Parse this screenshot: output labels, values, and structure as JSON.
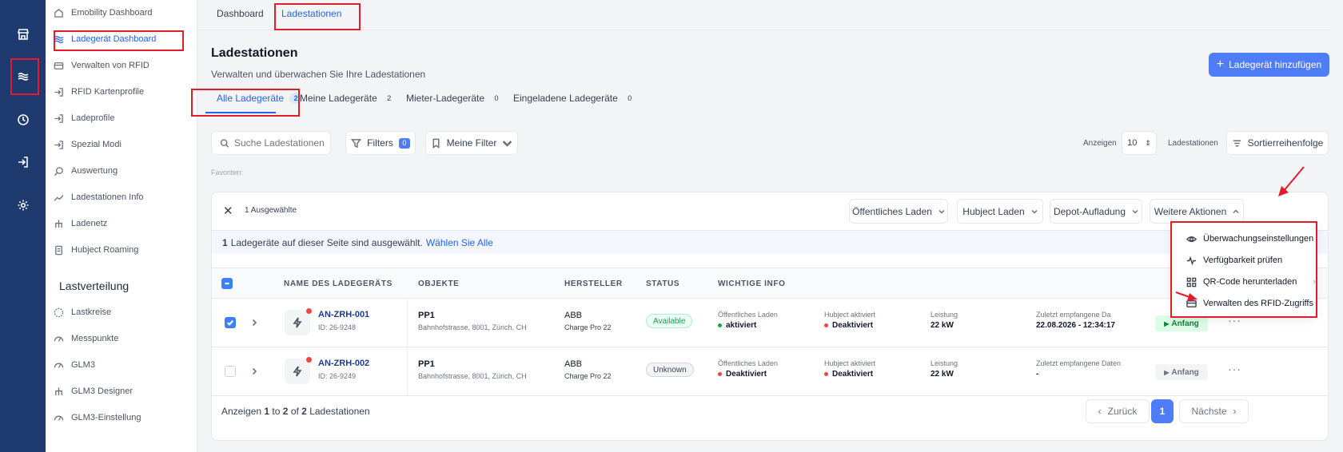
{
  "rail": {
    "icons": [
      "store-icon",
      "charger-waves-icon",
      "clock-icon",
      "login-icon",
      "settings-gear-icon"
    ]
  },
  "nav": {
    "items": [
      {
        "label": "Emobility Dashboard",
        "icon": "home-icon"
      },
      {
        "label": "Ladegerät Dashboard",
        "icon": "waves-icon",
        "active": true
      },
      {
        "label": "Verwalten von RFID",
        "icon": "card-icon"
      },
      {
        "label": "RFID Kartenprofile",
        "icon": "login-arrow-icon"
      },
      {
        "label": "Ladeprofile",
        "icon": "login-arrow-icon"
      },
      {
        "label": "Spezial Modi",
        "icon": "login-arrow-icon"
      },
      {
        "label": "Auswertung",
        "icon": "search-icon"
      },
      {
        "label": "Ladestationen Info",
        "icon": "trend-icon"
      },
      {
        "label": "Ladenetz",
        "icon": "network-icon"
      },
      {
        "label": "Hubject Roaming",
        "icon": "document-icon"
      }
    ],
    "section_title": "Lastverteilung",
    "section_items": [
      {
        "label": "Lastkreise",
        "icon": "circle-dashed-icon"
      },
      {
        "label": "Messpunkte",
        "icon": "gauge-icon"
      },
      {
        "label": "GLM3",
        "icon": "gauge-icon"
      },
      {
        "label": "GLM3 Designer",
        "icon": "network-icon"
      },
      {
        "label": "GLM3-Einstellung",
        "icon": "gauge-icon"
      }
    ]
  },
  "top_tabs": {
    "dashboard": "Dashboard",
    "ladestationen": "Ladestationen"
  },
  "page": {
    "title": "Ladestationen",
    "subtitle": "Verwalten und überwachen Sie Ihre Ladestationen",
    "add_button": "Ladegerät hinzufügen"
  },
  "tabs": [
    {
      "label": "Alle Ladegeräte",
      "count": "2"
    },
    {
      "label": "Meine Ladegeräte",
      "count": "2"
    },
    {
      "label": "Mieter-Ladegeräte",
      "count": "0"
    },
    {
      "label": "Eingeladene Ladegeräte",
      "count": "0"
    }
  ],
  "toolbar": {
    "search_placeholder": "Suche Ladestationen",
    "filters_label": "Filters",
    "filters_count": "0",
    "my_filter_label": "Meine Filter",
    "show_label": "Anzeigen",
    "page_size": "10",
    "page_size_suffix": "Ladestationen",
    "sort_label": "Sortierreihenfolge",
    "favorites_label": "Favoriten:"
  },
  "selection": {
    "count_label": "1 Ausgewählte",
    "actions": [
      "Öffentliches Laden",
      "Hubject Laden",
      "Depot-Aufladung",
      "Weitere Aktionen"
    ],
    "info_count": "1",
    "info_text": "Ladegeräte auf dieser Seite sind ausgewählt.",
    "select_all": "Wählen Sie Alle"
  },
  "table": {
    "headers": [
      "NAME DES LADEGERÄTS",
      "OBJEKTE",
      "HERSTELLER",
      "STATUS",
      "WICHTIGE INFO"
    ],
    "rows": [
      {
        "checked": true,
        "name": "AN-ZRH-001",
        "id": "ID: 26-9248",
        "object": "PP1",
        "address": "Bahnhofstrasse, 8001, Zürich, CH",
        "maker": "ABB",
        "model": "Charge Pro 22",
        "status": "Available",
        "public_label": "Öffentliches Laden",
        "public_value": "aktiviert",
        "hubject_label": "Hubject aktiviert",
        "hubject_value": "Deaktiviert",
        "power_label": "Leistung",
        "power_value": "22 kW",
        "last_label": "Zuletzt empfangene Da",
        "last_value": "22.08.2026 - 12:34:17",
        "action": "Anfang"
      },
      {
        "checked": false,
        "name": "AN-ZRH-002",
        "id": "ID: 26-9249",
        "object": "PP1",
        "address": "Bahnhofstrasse, 8001, Zürich, CH",
        "maker": "ABB",
        "model": "Charge Pro 22",
        "status": "Unknown",
        "public_label": "Öffentliches Laden",
        "public_value": "Deaktiviert",
        "hubject_label": "Hubject aktiviert",
        "hubject_value": "Deaktiviert",
        "power_label": "Leistung",
        "power_value": "22 kW",
        "last_label": "Zuletzt empfangene Daten",
        "last_value": "-",
        "action": "Anfang"
      }
    ]
  },
  "footer": {
    "w1": "Anzeigen",
    "n1": "1",
    "w2": "to",
    "n2": "2",
    "w3": "of",
    "n3": "2",
    "w4": "Ladestationen",
    "prev": "Zurück",
    "page": "1",
    "next": "Nächste"
  },
  "menu": {
    "items": [
      {
        "label": "Überwachungseinstellungen",
        "icon": "eye-icon"
      },
      {
        "label": "Verfügbarkeit prüfen",
        "icon": "pulse-icon"
      },
      {
        "label": "QR-Code herunterladen",
        "icon": "qr-grid-icon"
      },
      {
        "label": "Verwalten des RFID-Zugriffs",
        "icon": "card-icon"
      }
    ]
  },
  "colors": {
    "rail_bg": "#1e3a6e",
    "accent": "#4f7cf7",
    "active_text": "#2563eb",
    "highlight": "#e11d2a",
    "available_green": "#16a34a",
    "status_red": "#ef4444"
  }
}
